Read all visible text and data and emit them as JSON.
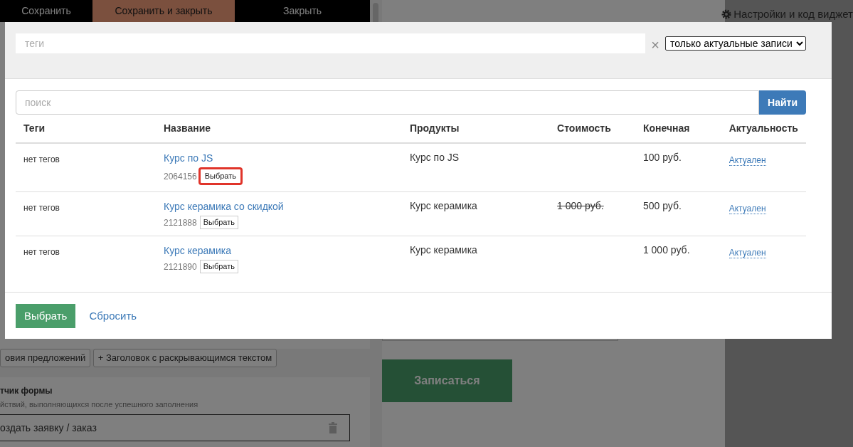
{
  "toolbar": {
    "buttons": [
      {
        "label": "Сохранить",
        "selected": false
      },
      {
        "label": "Сохранить и закрыть",
        "selected": true
      },
      {
        "label": "Закрыть",
        "selected": false
      }
    ]
  },
  "settings_link": "Настройки и код виджет",
  "editor": {
    "blocks": [
      "овия предложений",
      "+ Заголовок с раскрывающимся текстом"
    ],
    "section_title": "тчик формы",
    "section_hint": "йствий, выполняющихся после успешного заполнения",
    "action": "оздать заявку / заказ"
  },
  "preview": {
    "submit": "Записаться"
  },
  "modal": {
    "tags_placeholder": "теги",
    "clear": "×",
    "filter": "только актуальные записи",
    "search_placeholder": "поиск",
    "search_button": "Найти",
    "columns": [
      "Теги",
      "Название",
      "Продукты",
      "Стоимость",
      "Конечная",
      "Актуальность"
    ],
    "rows": [
      {
        "tags": "нет тегов",
        "title": "Курс по JS",
        "id": "2064156",
        "choose": "Выбрать",
        "highlighted": true,
        "product": "Курс по JS",
        "final": "100 руб.",
        "status": "Актуален"
      },
      {
        "tags": "нет тегов",
        "title": "Курс керамика со скидкой",
        "id": "2121888",
        "choose": "Выбрать",
        "highlighted": false,
        "product": "Курс керамика",
        "price": "1 000 руб.",
        "struck": true,
        "final": "500 руб.",
        "status": "Актуален"
      },
      {
        "tags": "нет тегов",
        "title": "Курс керамика",
        "id": "2121890",
        "choose": "Выбрать",
        "highlighted": false,
        "product": "Курс керамика",
        "final": "1 000 руб.",
        "status": "Актуален"
      }
    ],
    "submit": "Выбрать",
    "reset": "Сбросить"
  }
}
